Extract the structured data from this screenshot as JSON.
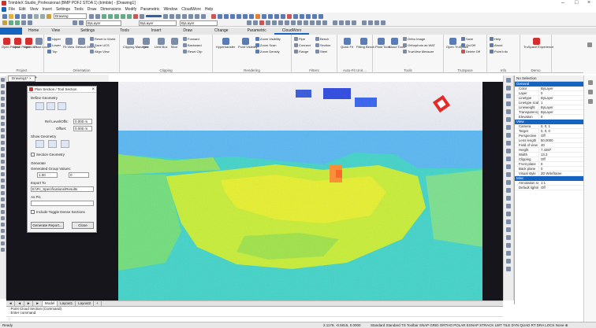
{
  "window": {
    "title": "TrimbleX Studio_Professional (BMP PDFJ STDA 1) (trimble) - [Drawing1]",
    "controls": [
      "–",
      "□",
      "×"
    ]
  },
  "menu": {
    "items": [
      "File",
      "Edit",
      "View",
      "Insert",
      "Settings",
      "Tools",
      "Draw",
      "Dimensions",
      "Modify",
      "Parametric",
      "Window",
      "CloudWorx",
      "Help"
    ]
  },
  "toolbar": {
    "drawing_combo": "Drawing",
    "layer_combo": "ByLayer",
    "linetype_combo": "ByLayer",
    "lineweight_combo": "ByLayer",
    "color_combo": "Bylayer"
  },
  "ribbon_tabs": [
    {
      "label": "",
      "active": true
    },
    {
      "label": "Home",
      "active": false
    },
    {
      "label": "View",
      "active": false
    },
    {
      "label": "Settings",
      "active": false
    },
    {
      "label": "Tools",
      "active": false
    },
    {
      "label": "Insert",
      "active": false
    },
    {
      "label": "Draw",
      "active": false
    },
    {
      "label": "Change",
      "active": false
    },
    {
      "label": "Parametric",
      "active": false
    },
    {
      "label": "CloudWorx",
      "active": false
    }
  ],
  "ribbon": {
    "groups": [
      {
        "label": "Project",
        "buttons": [
          "Open\nProject",
          "Close\nProject",
          "Open\nAPI",
          "Load\nLocal"
        ]
      },
      {
        "label": "Orientation",
        "buttons": [
          "Upper",
          "Lower",
          "Top",
          "Fit View",
          "Default\nOrient",
          "Set UCS",
          "Reset to World",
          "Save UCS",
          "Align View"
        ]
      },
      {
        "label": "Clipping",
        "buttons": [
          "Clipping\nManager",
          "Hide",
          "Limit Box",
          "Slice",
          "Forward",
          "Backward",
          "Reset Clip"
        ]
      },
      {
        "label": "Rendering",
        "buttons": [
          "Hypertransfer",
          "Point\nVisibility",
          "Zoom Visibility",
          "Zoom Scan",
          "Zoom Density"
        ]
      },
      {
        "label": "Fitters",
        "buttons": [
          "Pipe",
          "Connect",
          "Flange",
          "Bench",
          "Section",
          "Steel"
        ]
      },
      {
        "label": "Auto-Fit Unit ...",
        "buttons": [
          "Quick\nFit",
          "Fitting\nBench"
        ]
      },
      {
        "label": "Tools",
        "buttons": [
          "Plant\nTools",
          "Cloud\nTools",
          "Ortho Image",
          "Orthophoto as WAT",
          "TrueView Measure"
        ]
      },
      {
        "label": "TruSpace",
        "buttons": [
          "Save",
          "On/Off",
          "Open\nTruSpace",
          "Delete Off"
        ]
      },
      {
        "label": "Info",
        "buttons": [
          "Help",
          "About",
          "Point Info"
        ]
      },
      {
        "label": "Demo",
        "buttons": [
          "TruSpace\nExperience"
        ]
      }
    ]
  },
  "document_tab": {
    "label": "Drawing1*",
    "close": "×",
    "add": "+"
  },
  "dialog": {
    "title": "Plan Section / Tool Section",
    "close": "×",
    "section1": "Define Geometry",
    "field1_label": "Ref Level/Offs:",
    "field1_value": "0.000 m",
    "field2_label": "Offset:",
    "field2_value": "0.000 m",
    "section2": "Show Geometry",
    "checkbox1": "Section Geometry",
    "section3": "Generate",
    "param_label": "Generated Group Values:",
    "param_a": "1.00",
    "param_b": "0",
    "section4": "Export To",
    "export_value": "E:\\Pc_Specifications\\Results",
    "section5": "As Pic",
    "checkbox2": "Include Toggle Dense Sections",
    "btn_generate": "Generate Report...",
    "btn_close": "Close"
  },
  "layout_tabs": [
    {
      "label": "Model",
      "active": true
    },
    {
      "label": "Layout1",
      "active": false
    },
    {
      "label": "Layout2",
      "active": false
    }
  ],
  "command": {
    "history": [
      ": Point Cloud Section (Command)",
      ": Enter command",
      ""
    ],
    "prompt": ":"
  },
  "statusbar": {
    "left": "Ready",
    "coords": "2.1179, -0.5815, 0.0000",
    "toggles": "Standard  Standard  TS Toolbar  SNAP  GRID  ORTHO  POLAR  ESNAP  STRACK  LWT  TILE  DYN  QUAD  RT  DRA  LOCK  None  ⊕"
  },
  "props": {
    "header": "No Selection",
    "sections": [
      {
        "title": "General",
        "rows": [
          [
            "Color",
            "ByLayer"
          ],
          [
            "Layer",
            "0"
          ],
          [
            "Linetype",
            "ByLayer"
          ],
          [
            "Linetype scale",
            "1"
          ],
          [
            "Lineweight",
            "ByLayer"
          ],
          [
            "Transparency",
            "ByLayer"
          ],
          [
            "Elevation",
            "0"
          ]
        ]
      },
      {
        "title": "View",
        "rows": [
          [
            "Camera",
            "0, 0, 1"
          ],
          [
            "Target",
            "0, 0, 0"
          ],
          [
            "Perspective",
            "Off"
          ],
          [
            "Lens length",
            "50.0000"
          ],
          [
            "Field of view",
            "40"
          ],
          [
            "Height",
            "7.4287"
          ],
          [
            "Width",
            "13.3"
          ],
          [
            "Clipping",
            "Off"
          ],
          [
            "Front plane",
            "0"
          ],
          [
            "Back plane",
            "0"
          ],
          [
            "Visual style",
            "2D Wireframe"
          ]
        ]
      },
      {
        "title": "Misc",
        "rows": [
          [
            "Annotation scale",
            "1:1"
          ],
          [
            "Default lighting",
            "Off"
          ]
        ]
      }
    ]
  },
  "colors": {
    "accent": "#1565c0",
    "app_logo": "#d32f2f",
    "viewport_bg": "#15151b"
  }
}
